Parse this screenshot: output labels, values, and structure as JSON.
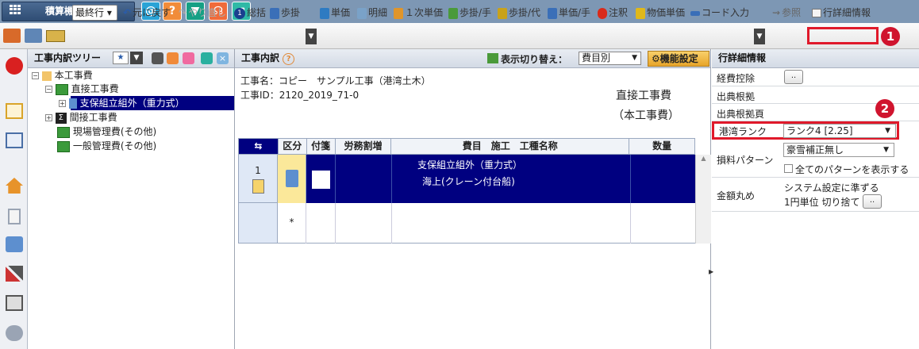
{
  "app": {
    "title": "積算機能一覧"
  },
  "toolbar": {
    "row_select": "最終行",
    "undo": "元に戻す",
    "redo": "やり直し",
    "summary": "総括",
    "ratio": "歩掛",
    "unit_price": "単価",
    "detail": "明細",
    "primary_unit_price": "１次単価",
    "ratio_hand": "歩掛/手",
    "ratio_sub": "歩掛/代",
    "unit_price_hand": "単価/手",
    "note": "注釈",
    "item_unit_price": "物価単価",
    "code_input": "コード入力",
    "reference": "参照",
    "row_detail_info": "行詳細情報",
    "callout1": "1"
  },
  "tree": {
    "title": "工事内訳ツリー",
    "items": [
      {
        "label": "本工事費"
      },
      {
        "label": "直接工事費"
      },
      {
        "label": "支保組立組外（重力式）"
      },
      {
        "label": "間接工事費"
      },
      {
        "label": "現場管理費(その他)"
      },
      {
        "label": "一般管理費(その他)"
      }
    ]
  },
  "main": {
    "title": "工事内訳",
    "view_switch_label": "表示切り替え：",
    "view_switch_value": "費目別",
    "func_settings": "機能設定",
    "project_name": "工事名：コピー　サンプル工事（港湾土木）",
    "project_id": "工事ID：2120_2019_71-0",
    "category_line1": "直接工事費",
    "category_line2": "（本工事費）",
    "columns": [
      "区分",
      "付箋",
      "労務割増",
      "費目　施工　工種名称",
      "数量"
    ],
    "rows": [
      {
        "no": "1",
        "name_line1": "支保組立組外（重力式）",
        "name_line2": "海上(クレーン付台船)"
      },
      {
        "no": "*"
      }
    ]
  },
  "detail": {
    "title": "行詳細情報",
    "expense_deduction": "経費控除",
    "source_basis": "出典根拠",
    "source_page": "出典根拠頁",
    "port_rank_label": "港湾ランク",
    "port_rank_value": "ランク4 [2.25]",
    "callout2": "2",
    "loss_pattern_label": "損料パターン",
    "loss_pattern_value": "豪雪補正無し",
    "show_all_patterns": "全てのパターンを表示する",
    "rounding_label": "金額丸め",
    "rounding_line1": "システム設定に準ずる",
    "rounding_line2": "1円単位 切り捨て",
    "button_dots": ".."
  },
  "colors": {
    "accent": "#e0192a",
    "selection": "#000080",
    "titlebar": "#7d97b4"
  }
}
